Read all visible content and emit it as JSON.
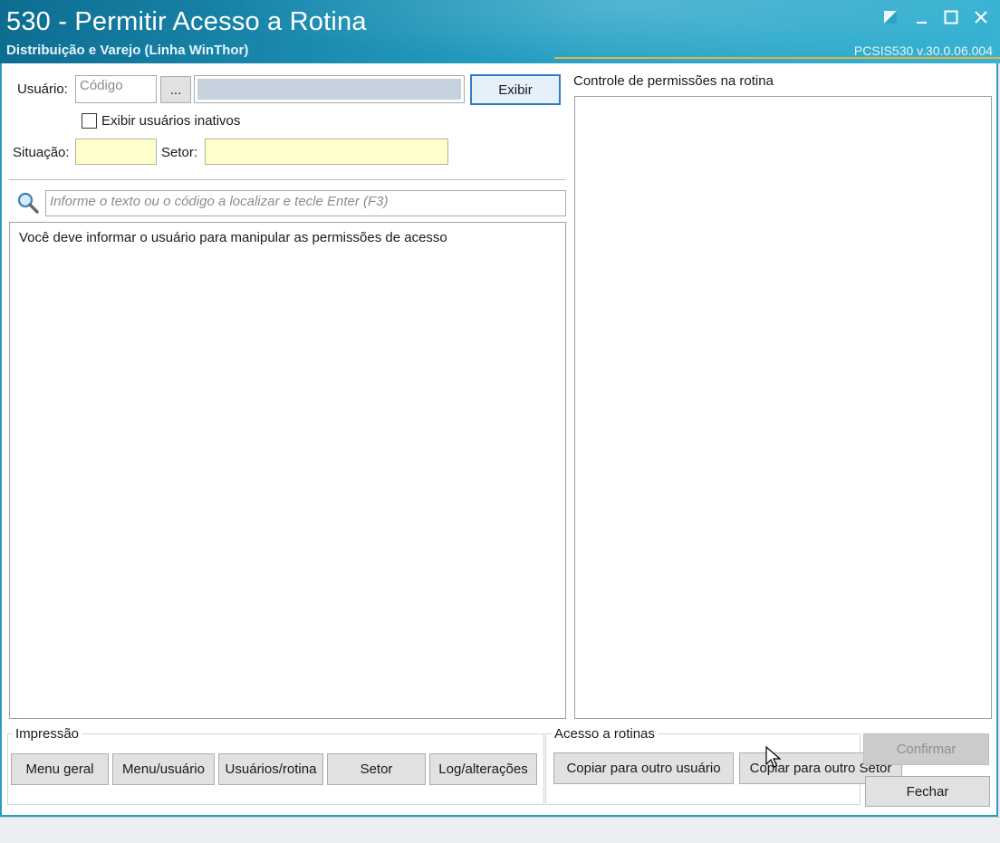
{
  "window": {
    "title": "530 - Permitir Acesso a Rotina",
    "subtitle": "Distribuição e Varejo (Linha WinThor)",
    "version": "PCSIS530  v.30.0.06.004",
    "controls": [
      "restore-down-icon",
      "minimize-icon",
      "maximize-icon",
      "close-icon"
    ]
  },
  "user_filter": {
    "usuario_label": "Usuário:",
    "codigo_placeholder": "Código",
    "ellipsis_label": "...",
    "nome_value": "",
    "exibir_label": "Exibir",
    "inativos_label": "Exibir usuários inativos",
    "inativos_checked": false,
    "situacao_label": "Situação:",
    "situacao_value": "",
    "setor_label": "Setor:",
    "setor_value": ""
  },
  "search": {
    "icon": "magnifier-icon",
    "placeholder": "Informe o texto ou o código a localizar e tecle Enter (F3)"
  },
  "routines_panel": {
    "message": "Você deve informar o usuário para manipular as permissões de acesso"
  },
  "permissions_panel": {
    "title": "Controle de permissões na rotina"
  },
  "impressao": {
    "title": "Impressão",
    "buttons": [
      "Menu geral",
      "Menu/usuário",
      "Usuários/rotina",
      "Setor",
      "Log/alterações"
    ]
  },
  "acesso": {
    "title": "Acesso a rotinas",
    "buttons": [
      "Copiar para outro usuário",
      "Copiar para outro Setor"
    ]
  },
  "actions": {
    "confirmar_label": "Confirmar",
    "confirmar_enabled": false,
    "fechar_label": "Fechar"
  },
  "colors": {
    "titlebar": "#1c8fb3",
    "accent_border": "#2a9ec0",
    "input_highlight": "#ffffcc",
    "focus_border": "#2f7dc8"
  }
}
